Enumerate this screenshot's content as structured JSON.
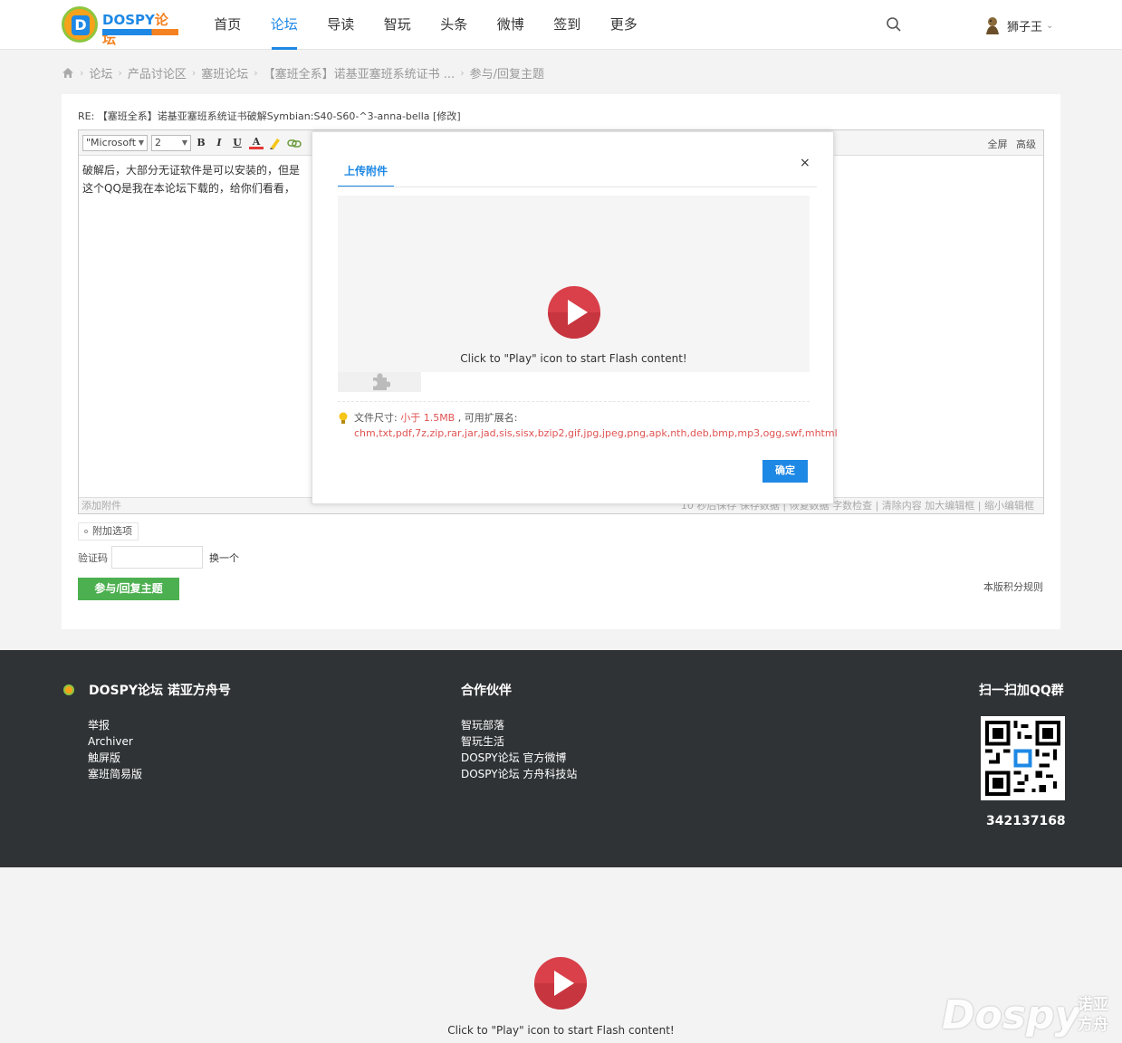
{
  "header": {
    "logo_text": "DOSPY",
    "logo_text_accent": "论坛",
    "nav": [
      {
        "label": "首页",
        "active": false
      },
      {
        "label": "论坛",
        "active": true
      },
      {
        "label": "导读",
        "active": false
      },
      {
        "label": "智玩",
        "active": false
      },
      {
        "label": "头条",
        "active": false
      },
      {
        "label": "微博",
        "active": false
      },
      {
        "label": "签到",
        "active": false
      },
      {
        "label": "更多",
        "active": false
      }
    ],
    "user_name": "狮子王"
  },
  "breadcrumb": [
    "论坛",
    "产品讨论区",
    "塞班论坛",
    "【塞班全系】诺基亚塞班系统证书 ...",
    "参与/回复主题"
  ],
  "post": {
    "title": "RE: 【塞班全系】诺基亚塞班系统证书破解Symbian:S40-S60-^3-anna-bella [修改]",
    "editor": {
      "font_value": "\"Microsoft",
      "size_value": "2",
      "buttons": {
        "bold": "B",
        "italic": "I",
        "underline": "U",
        "color": "A"
      },
      "fullscreen": "全屏",
      "advanced": "高级",
      "content_line1": "破解后，大部分无证软件是可以安装的，但是",
      "content_line2": "这个QQ是我在本论坛下载的，给你们看看，",
      "status_left": "添加附件",
      "status_right": "10 秒后保存 保存数据 | 恢复数据    字数检查 | 清除内容    加大编辑框 | 缩小编辑框"
    },
    "attach_option": "附加选项",
    "captcha_label": "验证码",
    "captcha_change": "换一个",
    "submit": "参与/回复主题",
    "rules": "本版积分规则"
  },
  "modal": {
    "tab": "上传附件",
    "close": "×",
    "flash_text": "Click to \"Play\" icon to start Flash content!",
    "size_label": "文件尺寸: ",
    "size_value": "小于 1.5MB",
    "ext_label": " , 可用扩展名:",
    "extensions": "chm,txt,pdf,7z,zip,rar,jar,jad,sis,sisx,bzip2,gif,jpg,jpeg,png,apk,nth,deb,bmp,mp3,ogg,swf,mhtml",
    "ok": "确定"
  },
  "footer": {
    "brand": "DOSPY论坛 诺亚方舟号",
    "links": [
      "举报",
      "Archiver",
      "触屏版",
      "塞班简易版"
    ],
    "partners_title": "合作伙伴",
    "partners": [
      "智玩部落",
      "智玩生活",
      "DOSPY论坛 官方微博",
      "DOSPY论坛 方舟科技站"
    ],
    "qq_title": "扫一扫加QQ群",
    "qq_number": "342137168"
  },
  "bottom": {
    "flash_text": "Click to \"Play\" icon to start Flash content!",
    "watermark": "Dospy",
    "watermark_cn": "诺亚方舟"
  },
  "colors": {
    "accent": "#1e88e5",
    "brand_orange": "#f58220",
    "submit_green": "#4caf50",
    "footer_bg": "#2f3336",
    "warning_red": "#e05353"
  }
}
